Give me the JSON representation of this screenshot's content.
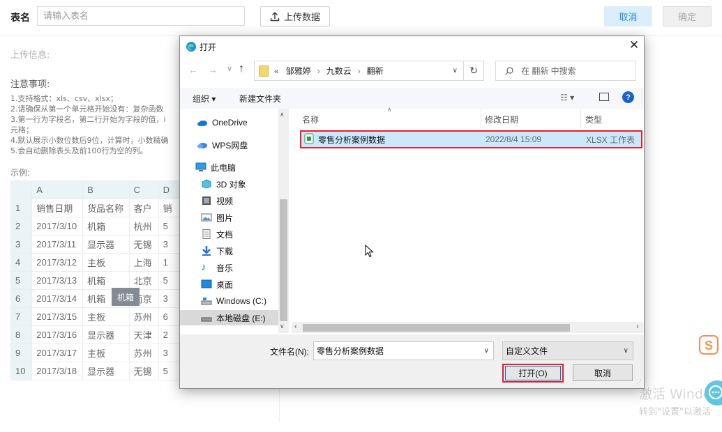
{
  "page": {
    "name_label": "表名",
    "name_placeholder": "请输入表名",
    "upload_label": "上传数据",
    "cancel_label": "取消",
    "confirm_label": "确定",
    "upload_info_label": "上传信息:",
    "notes_title": "注意事项:",
    "notes": [
      "1.支持格式：xls、csv、xlsx；",
      "2.请确保从第一个单元格开始没有：复杂函数",
      "3.第一行为字段名，第二行开始为字段的值，i",
      "元格；",
      "4.默认展示小数位数后9位，计算时，小数精确",
      "5.会自动删除表头及前100行为空的列。"
    ],
    "example_label": "示例:",
    "table": {
      "col_headers": [
        "A",
        "B",
        "C",
        "D"
      ],
      "rows": [
        [
          "1",
          "销售日期",
          "货品名称",
          "客户",
          "销"
        ],
        [
          "2",
          "2017/3/10",
          "机箱",
          "杭州",
          "5"
        ],
        [
          "3",
          "2017/3/11",
          "显示器",
          "无锡",
          "3"
        ],
        [
          "4",
          "2017/3/12",
          "主板",
          "上海",
          "1"
        ],
        [
          "5",
          "2017/3/13",
          "机箱",
          "北京",
          "5"
        ],
        [
          "6",
          "2017/3/14",
          "机箱",
          "南京",
          "3"
        ],
        [
          "7",
          "2017/3/15",
          "主板",
          "苏州",
          "6"
        ],
        [
          "8",
          "2017/3/16",
          "显示器",
          "天津",
          "2"
        ],
        [
          "9",
          "2017/3/17",
          "主板",
          "苏州",
          "3"
        ],
        [
          "10",
          "2017/3/18",
          "显示器",
          "无锡",
          "5"
        ]
      ]
    },
    "tooltip": "机箱",
    "watermark_title": "激活 Windows",
    "watermark_sub": "转到\"设置\"以激活"
  },
  "dialog": {
    "title": "打开",
    "breadcrumb": [
      "邹雅婷",
      "九数云",
      "翻新"
    ],
    "breadcrumb_prefix": "«",
    "search_placeholder": "在 翻新 中搜索",
    "organize_label": "组织 ▾",
    "new_folder_label": "新建文件夹",
    "nav_items": [
      {
        "label": "OneDrive",
        "icon": "cloud-icon"
      },
      {
        "label": "WPS网盘",
        "icon": "cloud-icon"
      },
      {
        "label": "此电脑",
        "icon": "computer-icon"
      },
      {
        "label": "3D 对象",
        "icon": "cube-icon"
      },
      {
        "label": "视频",
        "icon": "video-icon"
      },
      {
        "label": "图片",
        "icon": "picture-icon"
      },
      {
        "label": "文档",
        "icon": "document-icon"
      },
      {
        "label": "下载",
        "icon": "download-icon"
      },
      {
        "label": "音乐",
        "icon": "music-icon"
      },
      {
        "label": "桌面",
        "icon": "desktop-icon"
      },
      {
        "label": "Windows (C:)",
        "icon": "drive-icon"
      },
      {
        "label": "本地磁盘 (E:)",
        "icon": "drive-icon"
      }
    ],
    "columns": {
      "name": "名称",
      "date": "修改日期",
      "type": "类型"
    },
    "files": [
      {
        "name": "零售分析案例数据",
        "date": "2022/8/4 15:09",
        "type": "XLSX 工作表"
      }
    ],
    "filename_label": "文件名(N):",
    "filename_value": "零售分析案例数据",
    "filetype_value": "自定义文件",
    "open_label": "打开(O)",
    "cancel_label": "取消"
  }
}
